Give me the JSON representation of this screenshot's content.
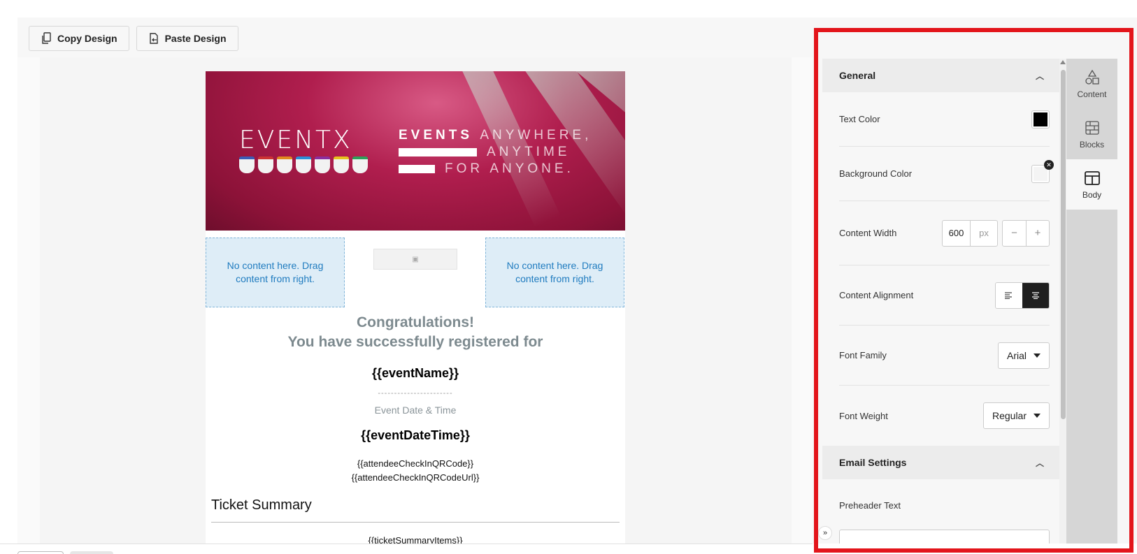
{
  "toolbar": {
    "copy_label": "Copy Design",
    "paste_label": "Paste Design"
  },
  "email": {
    "banner": {
      "logo_text": "EVENTX",
      "line1_strong": "EVENTS",
      "line1_soft": "ANYWHERE,",
      "line2_soft": "ANYTIME",
      "line3_soft": "FOR ANYONE."
    },
    "empty_left": "No content here. Drag content from right.",
    "empty_right": "No content here. Drag content from right.",
    "congrats_line1": "Congratulations!",
    "congrats_line2": "You have successfully registered for",
    "event_name": "{{eventName}}",
    "divider": "-----------------------",
    "date_label": "Event Date & Time",
    "date_value": "{{eventDateTime}}",
    "qr_line1": "{{attendeeCheckInQRCode}}",
    "qr_line2": "{{attendeeCheckInQRCodeUrl}}",
    "ticket_title": "Ticket Summary",
    "ticket_items": "{{ticketSummaryItems}}"
  },
  "panel": {
    "general_title": "General",
    "text_color_label": "Text Color",
    "text_color_value": "#000000",
    "bg_color_label": "Background Color",
    "content_width_label": "Content Width",
    "content_width_value": "600",
    "content_width_unit": "px",
    "minus": "−",
    "plus": "+",
    "content_alignment_label": "Content Alignment",
    "font_family_label": "Font Family",
    "font_family_value": "Arial",
    "font_weight_label": "Font Weight",
    "font_weight_value": "Regular",
    "email_settings_title": "Email Settings",
    "preheader_label": "Preheader Text"
  },
  "tabs": [
    {
      "label": "Content",
      "icon": "shapes-icon"
    },
    {
      "label": "Blocks",
      "icon": "blocks-icon"
    },
    {
      "label": "Body",
      "icon": "body-layout-icon",
      "active": true
    }
  ],
  "colors": {
    "highlight_border": "#e3151b",
    "accent_dark": "#1f1f1f",
    "dropzone_bg": "#deedf7",
    "dropzone_text": "#1f7bbf"
  }
}
